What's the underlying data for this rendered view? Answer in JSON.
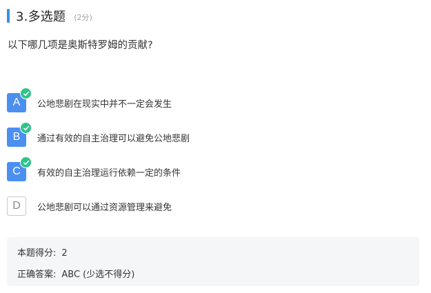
{
  "question": {
    "title": "3.多选题",
    "score": "(2分)",
    "text": "以下哪几项是奥斯特罗姆的贡献?"
  },
  "options": [
    {
      "letter": "A",
      "text": "公地悲剧在现实中并不一定会发生",
      "selected": true
    },
    {
      "letter": "B",
      "text": "通过有效的自主治理可以避免公地悲剧",
      "selected": true
    },
    {
      "letter": "C",
      "text": "有效的自主治理运行依赖一定的条件",
      "selected": true
    },
    {
      "letter": "D",
      "text": "公地悲剧可以通过资源管理来避免",
      "selected": false
    }
  ],
  "result": {
    "score_label": "本题得分:",
    "score_value": "2",
    "answer_label": "正确答案:",
    "answer_value": "ABC (少选不得分)"
  },
  "colors": {
    "accent": "#4b8ff0",
    "check": "#2ec38b",
    "panel": "#f5f6f7"
  },
  "icons": {
    "check": "check-circle-icon"
  }
}
